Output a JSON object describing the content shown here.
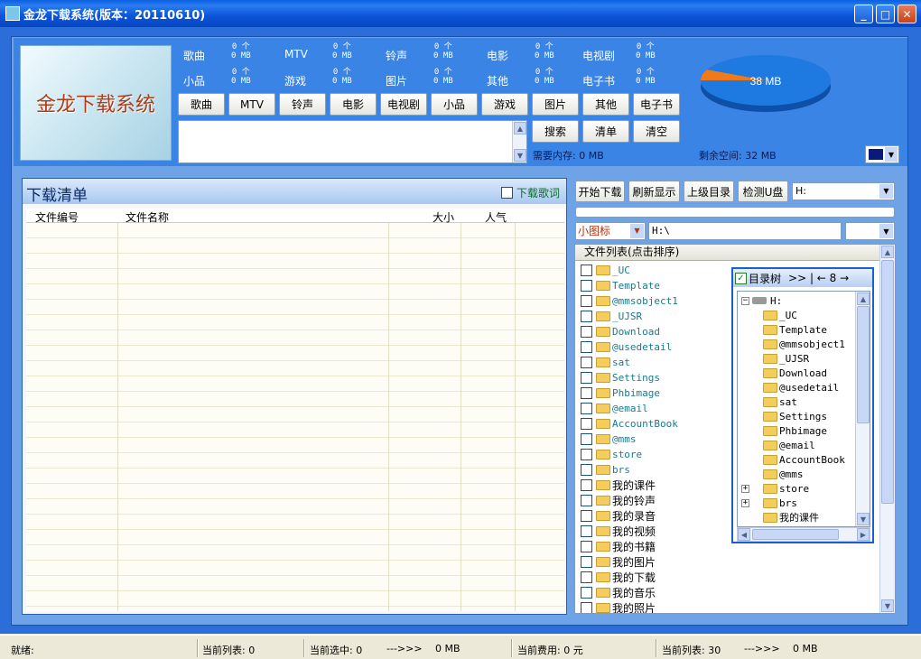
{
  "window": {
    "title": "金龙下载系统(版本：20110610)"
  },
  "logo": {
    "text": "金龙下载系统"
  },
  "categories": [
    {
      "label": "歌曲",
      "count": "0 个",
      "size": "0 MB"
    },
    {
      "label": "MTV",
      "count": "0 个",
      "size": "0 MB"
    },
    {
      "label": "铃声",
      "count": "0 个",
      "size": "0 MB"
    },
    {
      "label": "电影",
      "count": "0 个",
      "size": "0 MB"
    },
    {
      "label": "电视剧",
      "count": "0 个",
      "size": "0 MB"
    },
    {
      "label": "小品",
      "count": "0 个",
      "size": "0 MB"
    },
    {
      "label": "游戏",
      "count": "0 个",
      "size": "0 MB"
    },
    {
      "label": "图片",
      "count": "0 个",
      "size": "0 MB"
    },
    {
      "label": "其他",
      "count": "0 个",
      "size": "0 MB"
    },
    {
      "label": "电子书",
      "count": "0 个",
      "size": "0 MB"
    }
  ],
  "category_buttons": [
    "歌曲",
    "MTV",
    "铃声",
    "电影",
    "电视剧",
    "小品",
    "游戏",
    "图片",
    "其他",
    "电子书"
  ],
  "action_buttons": [
    "搜索",
    "清单",
    "清空"
  ],
  "pie": {
    "label": "38 MB",
    "used_color": "#f07a1a",
    "free_color": "#1e7ae0",
    "used_fraction": 0.07
  },
  "memory": {
    "required": "需要内存: 0 MB",
    "remaining": "剩余空间: 32 MB"
  },
  "download_list": {
    "title": "下载清单",
    "lyrics_checkbox": "下载歌词",
    "columns": [
      "文件编号",
      "文件名称",
      "大小",
      "人气"
    ]
  },
  "toolbar": {
    "start": "开始下载",
    "refresh": "刷新显示",
    "parent": "上级目录",
    "detect": "检测U盘",
    "drive": "H:"
  },
  "view": {
    "mode": "小图标",
    "path": "H:\\"
  },
  "file_list": {
    "header": "文件列表(点击排序)",
    "items": [
      "_UC",
      "Template",
      "@mmsobject1",
      "_UJSR",
      "Download",
      "@usedetail",
      "sat",
      "Settings",
      "Phbimage",
      "@email",
      "AccountBook",
      "@mms",
      "store",
      "brs",
      "我的课件",
      "我的铃声",
      "我的录音",
      "我的视频",
      "我的书籍",
      "我的图片",
      "我的下载",
      "我的音乐",
      "我的照片"
    ]
  },
  "tree": {
    "title": "目录树",
    "nav": ">> | ← 8 →",
    "root": "H:",
    "items": [
      "_UC",
      "Template",
      "@mmsobject1",
      "_UJSR",
      "Download",
      "@usedetail",
      "sat",
      "Settings",
      "Phbimage",
      "@email",
      "AccountBook",
      "@mms",
      "store",
      "brs",
      "我的课件"
    ]
  },
  "statusbar": {
    "ready": "就绪:",
    "current_list": "当前列表: 0",
    "selected": "当前选中: 0",
    "arrow1": "--->>>",
    "selected_size": "0 MB",
    "cost": "当前费用: 0 元",
    "current_list2": "当前列表: 30",
    "arrow2": "--->>>",
    "list_size": "0 MB"
  }
}
